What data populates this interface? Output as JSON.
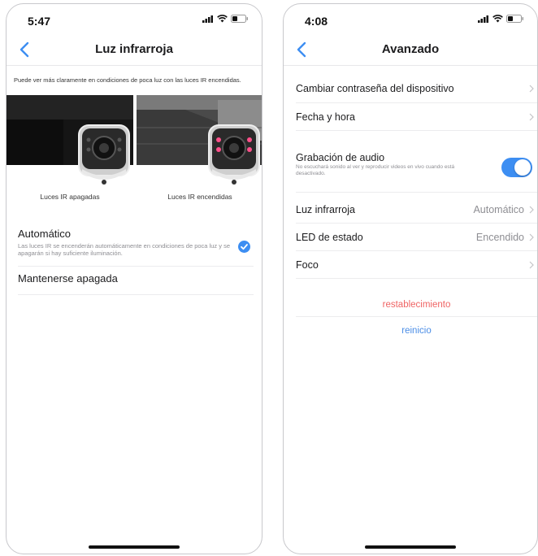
{
  "colors": {
    "accent": "#3d8ef2",
    "danger": "#ef6464",
    "link": "#4a8de6"
  },
  "left_screen": {
    "status_time": "5:47",
    "nav_title": "Luz infrarroja",
    "description": "Puede ver más claramente en condiciones de poca luz con las luces IR encendidas.",
    "preview_off_label": "Luces IR apagadas",
    "preview_on_label": "Luces IR encendidas",
    "options": [
      {
        "title": "Automático",
        "subtitle": "Las luces IR se encenderán automáticamente en condiciones de poca luz y se apagarán si hay suficiente iluminación.",
        "selected": true
      },
      {
        "title": "Mantenerse apagada",
        "selected": false
      }
    ]
  },
  "right_screen": {
    "status_time": "4:08",
    "nav_title": "Avanzado",
    "rows": [
      {
        "label": "Cambiar contraseña del dispositivo"
      },
      {
        "label": "Fecha y hora"
      },
      {
        "label": "Grabación de audio",
        "subtitle": "No escuchará sonido al ver y reproducir videos en vivo cuando está desactivado.",
        "toggle_on": true
      },
      {
        "label": "Luz infrarroja",
        "value": "Automático"
      },
      {
        "label": "LED de estado",
        "value": "Encendido"
      },
      {
        "label": "Foco"
      }
    ],
    "reset_label": "restablecimiento",
    "reboot_label": "reinicio"
  }
}
